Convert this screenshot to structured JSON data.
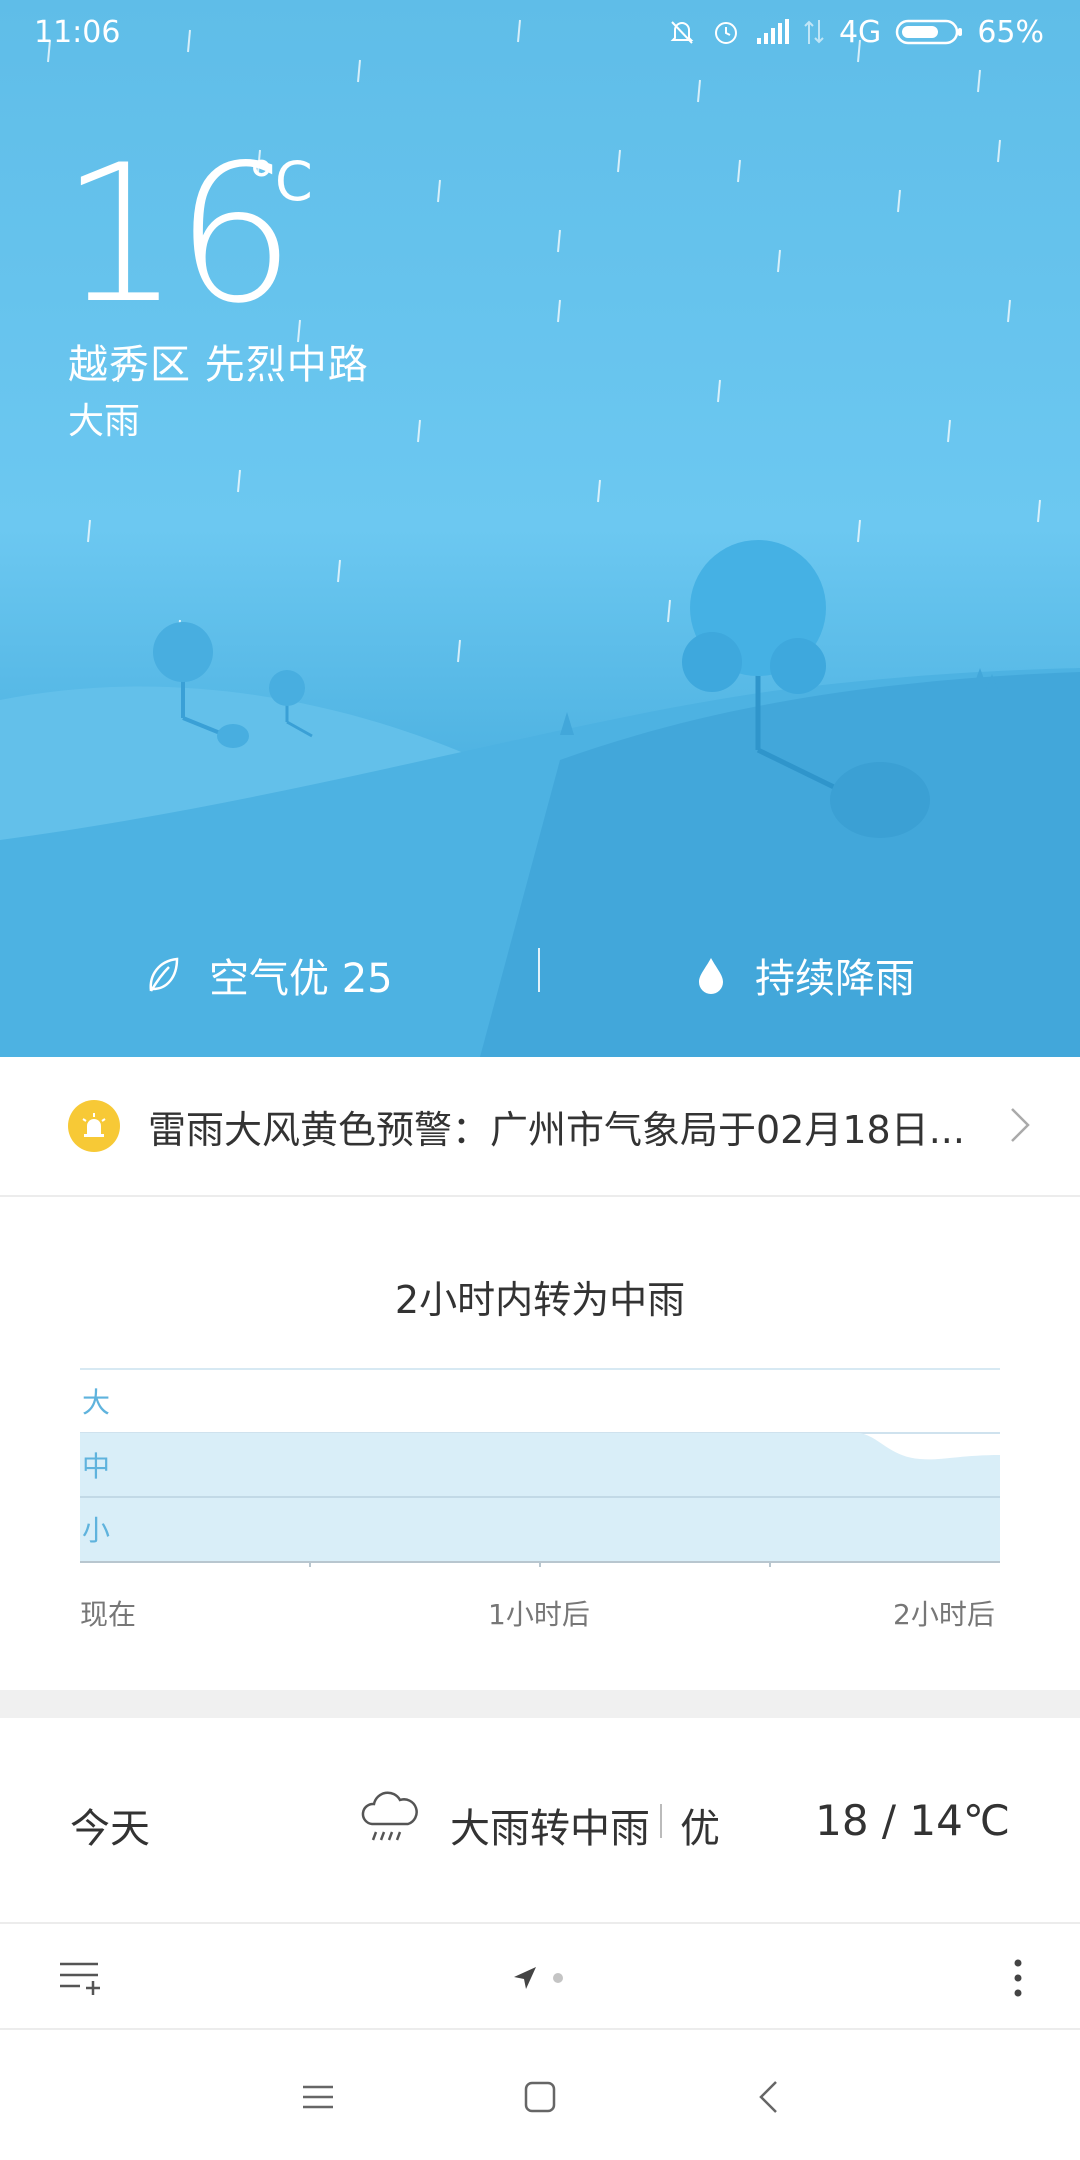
{
  "status_bar": {
    "time": "11:06",
    "network": "4G",
    "battery": "65%",
    "icons": [
      "bell-off-icon",
      "alarm-icon",
      "signal-icon",
      "data-arrows-icon",
      "battery-icon"
    ]
  },
  "current": {
    "temperature": "16",
    "unit": "°C",
    "location": "越秀区  先烈中路",
    "condition": "大雨"
  },
  "metrics": {
    "air_label": "空气优 25",
    "rain_label": "持续降雨",
    "air_icon": "leaf-icon",
    "rain_icon": "water-drop-icon"
  },
  "alert": {
    "text": "雷雨大风黄色预警：广州市气象局于02月18日...",
    "icon": "warning-siren-icon",
    "accent": "#f7c936"
  },
  "precip": {
    "title": "2小时内转为中雨",
    "y_levels": [
      "大",
      "中",
      "小"
    ],
    "x_labels": [
      "现在",
      "1小时后",
      "2小时后"
    ],
    "fill_color": "#d9eef8",
    "label_color": "#5fb3dd"
  },
  "forecast": {
    "day": "今天",
    "icon": "rain-cloud-icon",
    "desc": "大雨转中雨",
    "aqi": "优",
    "temp": "18 / 14℃"
  },
  "toolbar": {
    "add_city_icon": "add-list-icon",
    "location_icon": "location-arrow-icon",
    "more_icon": "more-vertical-icon"
  },
  "navbar": {
    "icons": [
      "menu-icon",
      "home-square-icon",
      "back-icon"
    ]
  },
  "colors": {
    "sky_top": "#5fbde8",
    "sky_bottom": "#3fa6d9",
    "text_dark": "#333333"
  }
}
